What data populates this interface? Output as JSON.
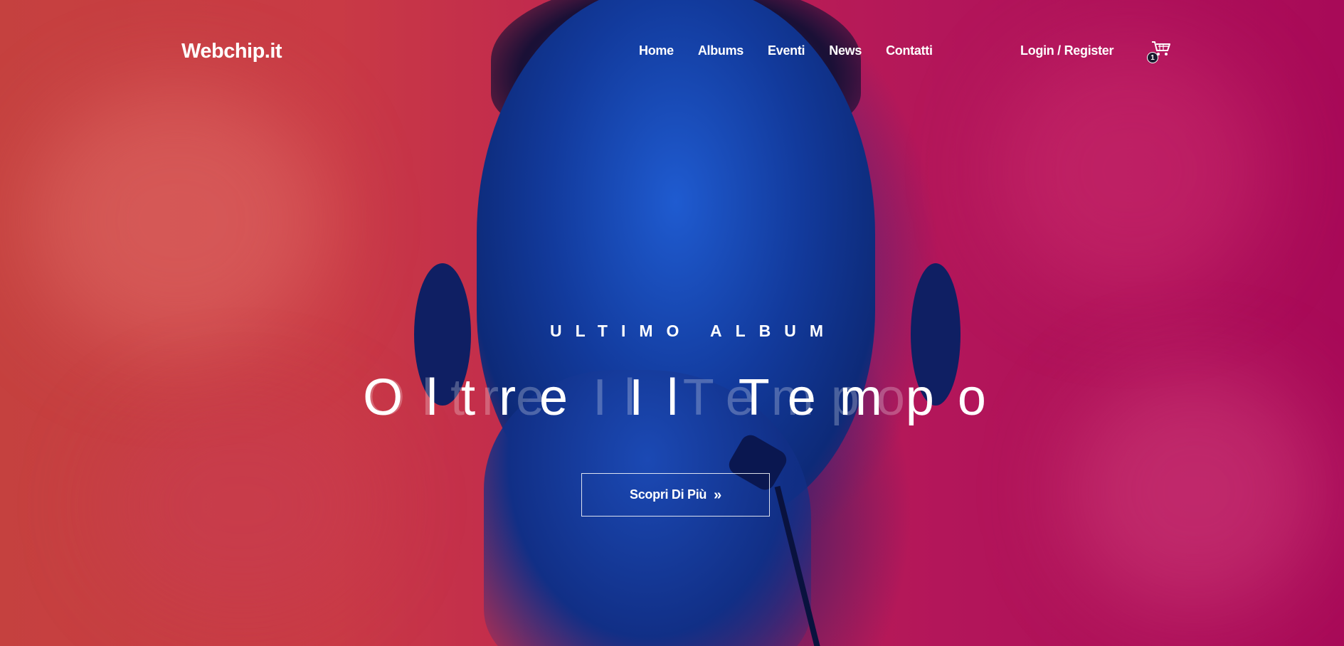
{
  "header": {
    "logo": "Webchip.it",
    "nav": [
      {
        "label": "Home"
      },
      {
        "label": "Albums"
      },
      {
        "label": "Eventi"
      },
      {
        "label": "News"
      },
      {
        "label": "Contatti"
      }
    ],
    "login_label": "Login / Register",
    "cart": {
      "icon": "cart-icon",
      "count": "1"
    }
  },
  "hero": {
    "eyebrow": "ULTIMO ALBUM",
    "title": "Oltre Il Tempo",
    "title_ghost": "Oltre Il Tempo",
    "cta_label": "Scopri Di Più",
    "cta_icon": "double-chevron-right-icon"
  },
  "colors": {
    "accent_left": "#c5413f",
    "accent_right": "#a80a58",
    "subject_blue": "#123a9c",
    "text": "#ffffff"
  }
}
